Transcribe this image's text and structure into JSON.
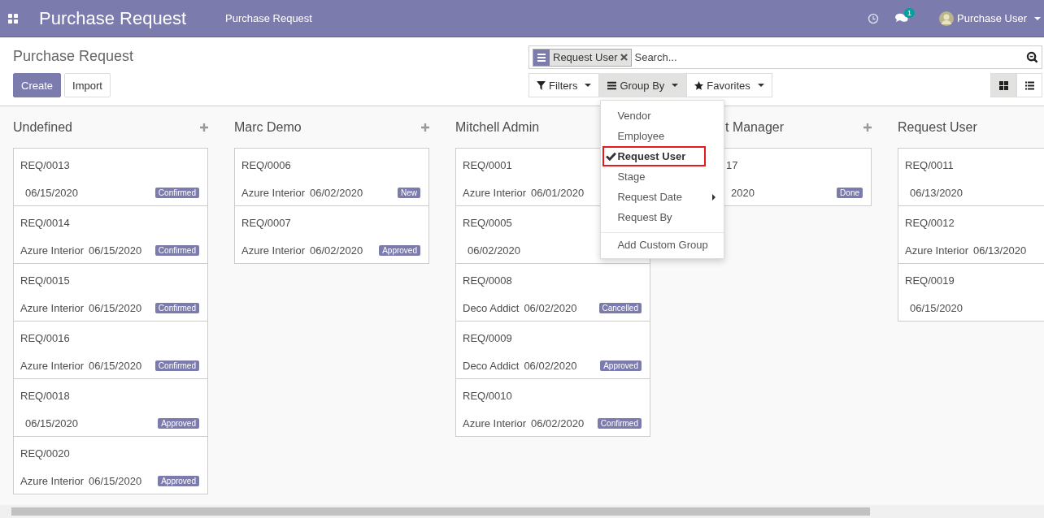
{
  "navbar": {
    "app_title": "Purchase Request",
    "menu": [
      {
        "label": "Purchase Request"
      }
    ],
    "chat_count": "1",
    "user": "Purchase User"
  },
  "breadcrumb": "Purchase Request",
  "buttons": [
    {
      "label": "Create",
      "kind": "primary"
    },
    {
      "label": "Import",
      "kind": "secondary"
    }
  ],
  "search": {
    "facets": [
      {
        "value": "Request User"
      }
    ],
    "placeholder": "Search..."
  },
  "search_menus": [
    {
      "label": "Filters",
      "kind": "filter",
      "open": false
    },
    {
      "label": "Group By",
      "kind": "group",
      "open": true
    },
    {
      "label": "Favorites",
      "kind": "favorite",
      "open": false
    }
  ],
  "group_by_menu": {
    "items": [
      {
        "label": "Vendor",
        "selected": false
      },
      {
        "label": "Employee",
        "selected": false
      },
      {
        "label": "Request User",
        "selected": true
      },
      {
        "label": "Stage",
        "selected": false
      },
      {
        "label": "Request Date",
        "selected": false,
        "submenu": true
      },
      {
        "label": "Request By",
        "selected": false
      }
    ],
    "custom_group": "Add Custom Group"
  },
  "views": [
    {
      "kind": "kanban",
      "selected": true
    },
    {
      "kind": "list",
      "selected": false
    }
  ],
  "columns": [
    {
      "title": "Undefined",
      "add_visible": true,
      "covered": false,
      "cards": [
        {
          "ref": "REQ/0013",
          "date": "06/15/2020",
          "status": "Confirmed"
        },
        {
          "ref": "REQ/0014",
          "vendor": "Azure Interior",
          "date": "06/15/2020",
          "status": "Confirmed"
        },
        {
          "ref": "REQ/0015",
          "vendor": "Azure Interior",
          "date": "06/15/2020",
          "status": "Confirmed"
        },
        {
          "ref": "REQ/0016",
          "vendor": "Azure Interior",
          "date": "06/15/2020",
          "status": "Confirmed"
        },
        {
          "ref": "REQ/0018",
          "date": "06/15/2020",
          "status": "Approved"
        },
        {
          "ref": "REQ/0020",
          "vendor": "Azure Interior",
          "date": "06/15/2020",
          "status": "Approved"
        }
      ]
    },
    {
      "title": "Marc Demo",
      "add_visible": true,
      "covered": false,
      "cards": [
        {
          "ref": "REQ/0006",
          "vendor": "Azure Interior",
          "date": "06/02/2020",
          "status": "New"
        },
        {
          "ref": "REQ/0007",
          "vendor": "Azure Interior",
          "date": "06/02/2020",
          "status": "Approved"
        }
      ]
    },
    {
      "title": "Mitchell Admin",
      "covered": false,
      "cards": [
        {
          "ref": "REQ/0001",
          "vendor": "Azure Interior",
          "date": "06/01/2020"
        },
        {
          "ref": "REQ/0005",
          "date": "06/02/2020"
        },
        {
          "ref": "REQ/0008",
          "vendor": "Deco Addict",
          "date": "06/02/2020",
          "status": "Cancelled"
        },
        {
          "ref": "REQ/0009",
          "vendor": "Deco Addict",
          "date": "06/02/2020",
          "status": "Approved"
        },
        {
          "ref": "REQ/0010",
          "vendor": "Azure Interior",
          "date": "06/02/2020",
          "status": "Confirmed"
        }
      ]
    },
    {
      "title": "t Manager",
      "add_visible": true,
      "covered": true,
      "cards": [
        {
          "ref": "17",
          "date": "2020",
          "status": "Done"
        }
      ]
    },
    {
      "title": "Request User",
      "covered": false,
      "cards": [
        {
          "ref": "REQ/0011",
          "date": "06/13/2020"
        },
        {
          "ref": "REQ/0012",
          "vendor": "Azure Interior",
          "date": "06/13/2020"
        },
        {
          "ref": "REQ/0019",
          "date": "06/15/2020"
        }
      ]
    }
  ]
}
